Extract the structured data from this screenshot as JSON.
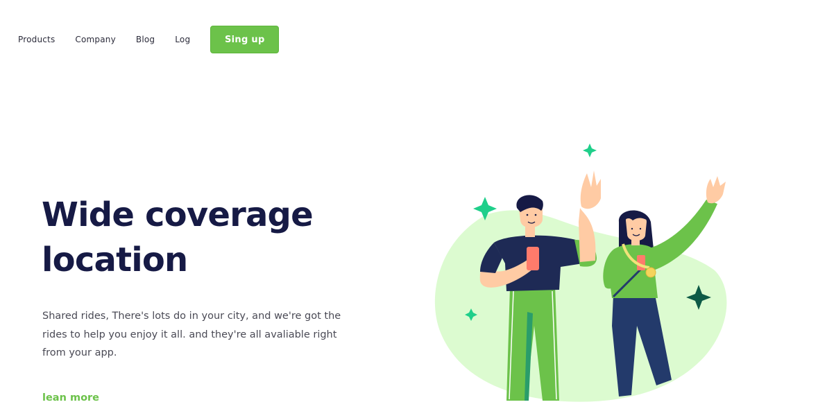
{
  "nav": {
    "links": [
      "Products",
      "Company",
      "Blog",
      "Log"
    ],
    "signup_label": "Sing up"
  },
  "hero": {
    "title_line1": "Wide coverage",
    "title_line2": "location",
    "description": "Shared rides, There's lots do in your city, and we're got the rides to help you enjoy it all. and they're all avaliable right from your app.",
    "cta": "lean more"
  },
  "colors": {
    "accent": "#6cc24a",
    "heading": "#161a45",
    "blob": "#dcfbd0",
    "sparkle": "#1fcf8a",
    "sparkle_dark": "#0d5a46"
  }
}
